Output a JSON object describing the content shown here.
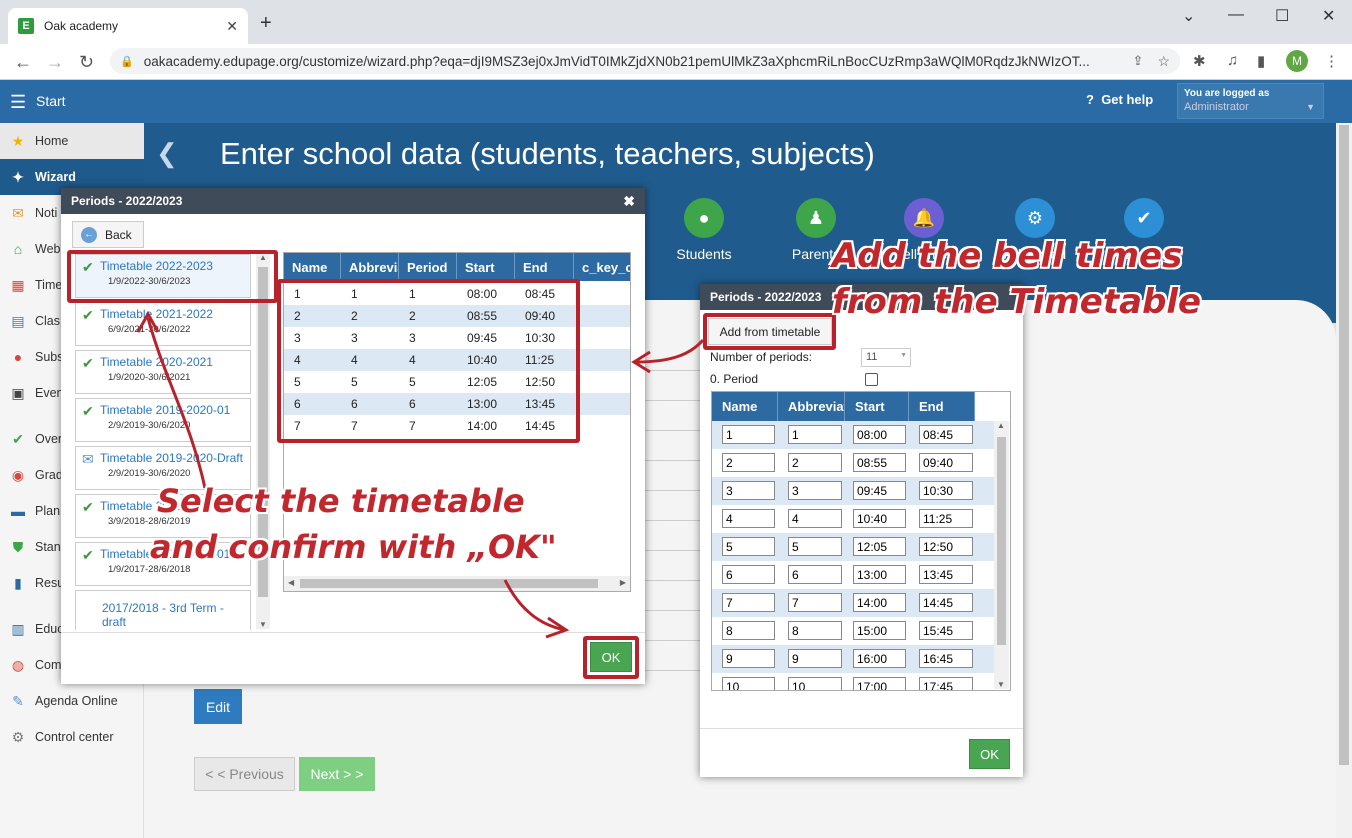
{
  "browser": {
    "tab_title": "Oak academy",
    "favicon": "E",
    "url": "oakacademy.edupage.org/customize/wizard.php?eqa=djI9MSZ3ej0xJmVidT0IMkZjdXN0b21pemUlMkZ3aXphcmRiLnBocCUzRmp3aWQlM0RqdzJkNWIzOT...",
    "profile_initial": "M"
  },
  "header": {
    "start_label": "Start",
    "help_label": "Get help",
    "logged_as_label": "You are logged as",
    "user_role": "Administrator"
  },
  "sidebar": {
    "items": [
      {
        "label": "Home",
        "icon": "star-icon"
      },
      {
        "label": "Wizard",
        "icon": "wand-icon"
      },
      {
        "label": "Noti",
        "icon": "mail-icon"
      },
      {
        "label": "Web",
        "icon": "house-icon"
      },
      {
        "label": "Time",
        "icon": "calendar-icon"
      },
      {
        "label": "Clas",
        "icon": "book-icon"
      },
      {
        "label": "Subs",
        "icon": "person-icon"
      },
      {
        "label": "Even",
        "icon": "briefcase-icon"
      },
      {
        "label": "Over",
        "icon": "check-icon"
      },
      {
        "label": "Grad",
        "icon": "grades-icon"
      },
      {
        "label": "Plan",
        "icon": "plan-icon"
      },
      {
        "label": "Stan",
        "icon": "shield-icon"
      },
      {
        "label": "Resu",
        "icon": "chart-icon"
      },
      {
        "label": "Educ",
        "icon": "education-icon"
      },
      {
        "label": "Com",
        "icon": "chat-icon"
      },
      {
        "label": "Agenda Online",
        "icon": "feather-icon"
      },
      {
        "label": "Control center",
        "icon": "gear-icon"
      }
    ]
  },
  "main": {
    "title": "Enter school data (students, teachers, subjects)",
    "steps": [
      {
        "label": "Students",
        "color": "#3fa54a"
      },
      {
        "label": "Parents",
        "color": "#3fa54a"
      },
      {
        "label": "Bell times",
        "color": "#6b5fd3"
      },
      {
        "label": "Advanced",
        "color": "#2d8fd6"
      },
      {
        "label": "Finish",
        "color": "#2d8fd6"
      }
    ],
    "edit_label": "Edit",
    "prev_label": "< < Previous",
    "next_label": "Next > >"
  },
  "dialog1": {
    "title": "Periods - 2022/2023",
    "back_label": "Back",
    "ok_label": "OK",
    "timetables": [
      {
        "name": "Timetable 2022-2023",
        "dates": "1/9/2022-30/6/2023",
        "status": "check"
      },
      {
        "name": "Timetable 2021-2022",
        "dates": "6/9/2021-30/6/2022",
        "status": "check"
      },
      {
        "name": "Timetable 2020-2021",
        "dates": "1/9/2020-30/6/2021",
        "status": "check"
      },
      {
        "name": "Timetable 2019-2020-01",
        "dates": "2/9/2019-30/6/2020",
        "status": "check"
      },
      {
        "name": "Timetable 2019-2020-Draft",
        "dates": "2/9/2019-30/6/2020",
        "status": "draft"
      },
      {
        "name": "Timetable 2018-",
        "dates": "3/9/2018-28/6/2019",
        "status": "check"
      },
      {
        "name": "Timetable 2017-2018-01",
        "dates": "1/9/2017-28/6/2018",
        "status": "check"
      },
      {
        "name": "2017/2018 - 3rd Term - draft",
        "dates": "",
        "status": "none"
      }
    ],
    "columns": [
      "Name",
      "Abbreviati",
      "Period",
      "Start",
      "End",
      "c_key_c"
    ],
    "rows": [
      [
        "1",
        "1",
        "1",
        "08:00",
        "08:45"
      ],
      [
        "2",
        "2",
        "2",
        "08:55",
        "09:40"
      ],
      [
        "3",
        "3",
        "3",
        "09:45",
        "10:30"
      ],
      [
        "4",
        "4",
        "4",
        "10:40",
        "11:25"
      ],
      [
        "5",
        "5",
        "5",
        "12:05",
        "12:50"
      ],
      [
        "6",
        "6",
        "6",
        "13:00",
        "13:45"
      ],
      [
        "7",
        "7",
        "7",
        "14:00",
        "14:45"
      ]
    ]
  },
  "dialog2": {
    "title": "Periods - 2022/2023",
    "add_from_timetable_label": "Add from timetable",
    "num_periods_label": "Number of periods:",
    "num_periods_value": "11",
    "zero_period_label": "0. Period",
    "ok_label": "OK",
    "columns": [
      "Name",
      "Abbreviati",
      "Start",
      "End"
    ],
    "rows": [
      [
        "1",
        "1",
        "08:00",
        "08:45"
      ],
      [
        "2",
        "2",
        "08:55",
        "09:40"
      ],
      [
        "3",
        "3",
        "09:45",
        "10:30"
      ],
      [
        "4",
        "4",
        "10:40",
        "11:25"
      ],
      [
        "5",
        "5",
        "12:05",
        "12:50"
      ],
      [
        "6",
        "6",
        "13:00",
        "13:45"
      ],
      [
        "7",
        "7",
        "14:00",
        "14:45"
      ],
      [
        "8",
        "8",
        "15:00",
        "15:45"
      ],
      [
        "9",
        "9",
        "16:00",
        "16:45"
      ],
      [
        "10",
        "10",
        "17:00",
        "17:45"
      ]
    ]
  },
  "annotations": {
    "top_right_line1": "Add the bell times",
    "top_right_line2": "from the Timetable",
    "left_line1": "Select the timetable",
    "left_line2": "and confirm with „OK\"",
    "color": "#c0282e"
  }
}
